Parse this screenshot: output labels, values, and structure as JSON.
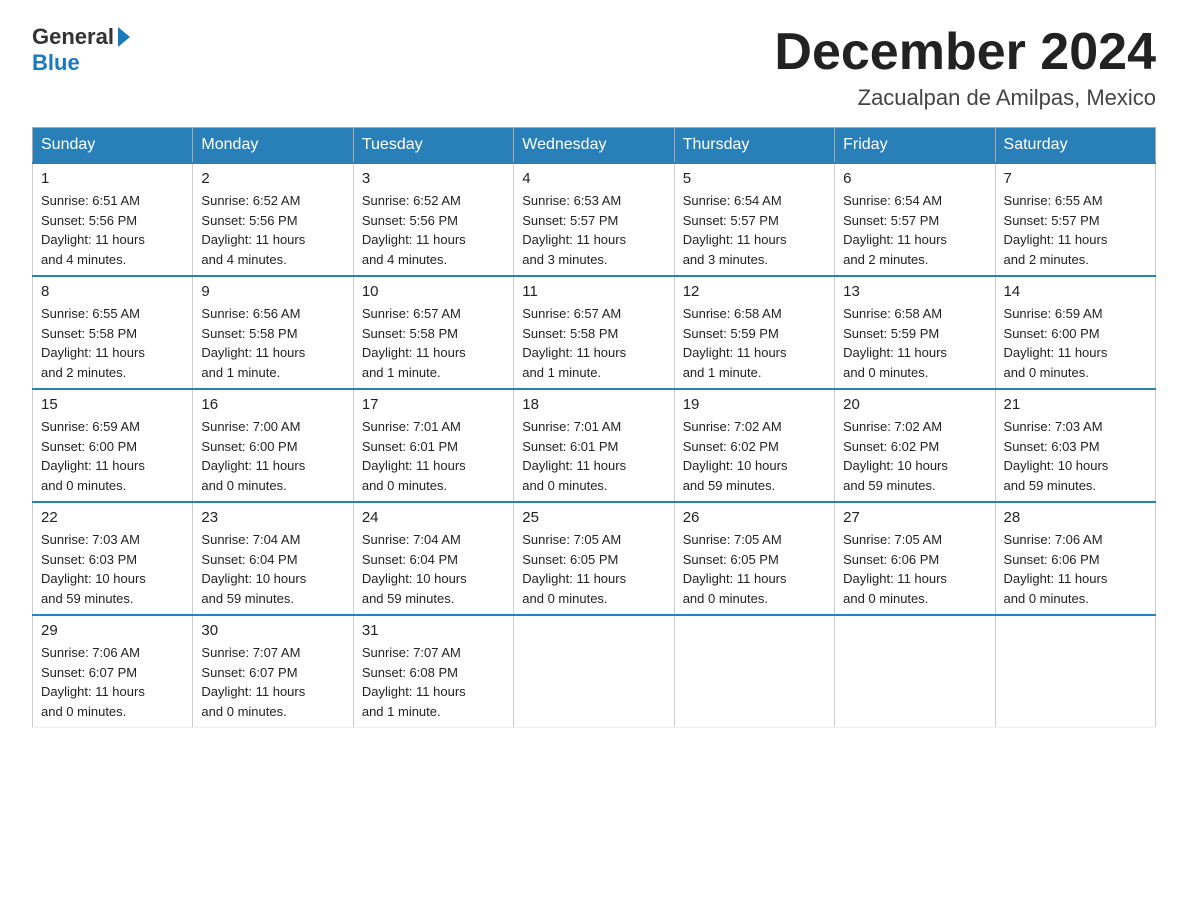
{
  "logo": {
    "general": "General",
    "blue": "Blue"
  },
  "header": {
    "month_year": "December 2024",
    "location": "Zacualpan de Amilpas, Mexico"
  },
  "days_of_week": [
    "Sunday",
    "Monday",
    "Tuesday",
    "Wednesday",
    "Thursday",
    "Friday",
    "Saturday"
  ],
  "weeks": [
    [
      {
        "day": "1",
        "sunrise": "6:51 AM",
        "sunset": "5:56 PM",
        "daylight": "11 hours and 4 minutes."
      },
      {
        "day": "2",
        "sunrise": "6:52 AM",
        "sunset": "5:56 PM",
        "daylight": "11 hours and 4 minutes."
      },
      {
        "day": "3",
        "sunrise": "6:52 AM",
        "sunset": "5:56 PM",
        "daylight": "11 hours and 4 minutes."
      },
      {
        "day": "4",
        "sunrise": "6:53 AM",
        "sunset": "5:57 PM",
        "daylight": "11 hours and 3 minutes."
      },
      {
        "day": "5",
        "sunrise": "6:54 AM",
        "sunset": "5:57 PM",
        "daylight": "11 hours and 3 minutes."
      },
      {
        "day": "6",
        "sunrise": "6:54 AM",
        "sunset": "5:57 PM",
        "daylight": "11 hours and 2 minutes."
      },
      {
        "day": "7",
        "sunrise": "6:55 AM",
        "sunset": "5:57 PM",
        "daylight": "11 hours and 2 minutes."
      }
    ],
    [
      {
        "day": "8",
        "sunrise": "6:55 AM",
        "sunset": "5:58 PM",
        "daylight": "11 hours and 2 minutes."
      },
      {
        "day": "9",
        "sunrise": "6:56 AM",
        "sunset": "5:58 PM",
        "daylight": "11 hours and 1 minute."
      },
      {
        "day": "10",
        "sunrise": "6:57 AM",
        "sunset": "5:58 PM",
        "daylight": "11 hours and 1 minute."
      },
      {
        "day": "11",
        "sunrise": "6:57 AM",
        "sunset": "5:58 PM",
        "daylight": "11 hours and 1 minute."
      },
      {
        "day": "12",
        "sunrise": "6:58 AM",
        "sunset": "5:59 PM",
        "daylight": "11 hours and 1 minute."
      },
      {
        "day": "13",
        "sunrise": "6:58 AM",
        "sunset": "5:59 PM",
        "daylight": "11 hours and 0 minutes."
      },
      {
        "day": "14",
        "sunrise": "6:59 AM",
        "sunset": "6:00 PM",
        "daylight": "11 hours and 0 minutes."
      }
    ],
    [
      {
        "day": "15",
        "sunrise": "6:59 AM",
        "sunset": "6:00 PM",
        "daylight": "11 hours and 0 minutes."
      },
      {
        "day": "16",
        "sunrise": "7:00 AM",
        "sunset": "6:00 PM",
        "daylight": "11 hours and 0 minutes."
      },
      {
        "day": "17",
        "sunrise": "7:01 AM",
        "sunset": "6:01 PM",
        "daylight": "11 hours and 0 minutes."
      },
      {
        "day": "18",
        "sunrise": "7:01 AM",
        "sunset": "6:01 PM",
        "daylight": "11 hours and 0 minutes."
      },
      {
        "day": "19",
        "sunrise": "7:02 AM",
        "sunset": "6:02 PM",
        "daylight": "10 hours and 59 minutes."
      },
      {
        "day": "20",
        "sunrise": "7:02 AM",
        "sunset": "6:02 PM",
        "daylight": "10 hours and 59 minutes."
      },
      {
        "day": "21",
        "sunrise": "7:03 AM",
        "sunset": "6:03 PM",
        "daylight": "10 hours and 59 minutes."
      }
    ],
    [
      {
        "day": "22",
        "sunrise": "7:03 AM",
        "sunset": "6:03 PM",
        "daylight": "10 hours and 59 minutes."
      },
      {
        "day": "23",
        "sunrise": "7:04 AM",
        "sunset": "6:04 PM",
        "daylight": "10 hours and 59 minutes."
      },
      {
        "day": "24",
        "sunrise": "7:04 AM",
        "sunset": "6:04 PM",
        "daylight": "10 hours and 59 minutes."
      },
      {
        "day": "25",
        "sunrise": "7:05 AM",
        "sunset": "6:05 PM",
        "daylight": "11 hours and 0 minutes."
      },
      {
        "day": "26",
        "sunrise": "7:05 AM",
        "sunset": "6:05 PM",
        "daylight": "11 hours and 0 minutes."
      },
      {
        "day": "27",
        "sunrise": "7:05 AM",
        "sunset": "6:06 PM",
        "daylight": "11 hours and 0 minutes."
      },
      {
        "day": "28",
        "sunrise": "7:06 AM",
        "sunset": "6:06 PM",
        "daylight": "11 hours and 0 minutes."
      }
    ],
    [
      {
        "day": "29",
        "sunrise": "7:06 AM",
        "sunset": "6:07 PM",
        "daylight": "11 hours and 0 minutes."
      },
      {
        "day": "30",
        "sunrise": "7:07 AM",
        "sunset": "6:07 PM",
        "daylight": "11 hours and 0 minutes."
      },
      {
        "day": "31",
        "sunrise": "7:07 AM",
        "sunset": "6:08 PM",
        "daylight": "11 hours and 1 minute."
      },
      null,
      null,
      null,
      null
    ]
  ],
  "labels": {
    "sunrise": "Sunrise:",
    "sunset": "Sunset:",
    "daylight": "Daylight:"
  }
}
